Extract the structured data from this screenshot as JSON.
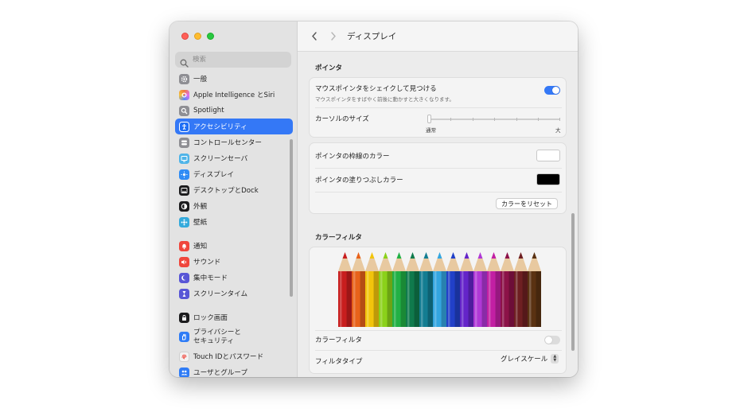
{
  "window": {
    "title": "ディスプレイ"
  },
  "search": {
    "placeholder": "検索"
  },
  "sidebar": {
    "items": [
      {
        "label": "一般",
        "icon": "gear-icon",
        "color": "#8e8e93"
      },
      {
        "label": "Apple Intelligence とSiri",
        "icon": "apple-intelligence-icon",
        "color": "#e26ef0"
      },
      {
        "label": "Spotlight",
        "icon": "spotlight-icon",
        "color": "#8e8e93"
      },
      {
        "label": "アクセシビリティ",
        "icon": "accessibility-icon",
        "color": "#1f6ef5",
        "active": true
      },
      {
        "label": "コントロールセンター",
        "icon": "control-center-icon",
        "color": "#8e8e93"
      },
      {
        "label": "スクリーンセーバ",
        "icon": "screen-saver-icon",
        "color": "#4fb4e8"
      },
      {
        "label": "ディスプレイ",
        "icon": "display-icon",
        "color": "#2f8cf5"
      },
      {
        "label": "デスクトップとDock",
        "icon": "dock-icon",
        "color": "#1c1c1e"
      },
      {
        "label": "外観",
        "icon": "appearance-icon",
        "color": "#1c1c1e"
      },
      {
        "label": "壁紙",
        "icon": "wallpaper-icon",
        "color": "#34aadc"
      },
      {
        "label": "通知",
        "icon": "notifications-icon",
        "color": "#f0463c"
      },
      {
        "label": "サウンド",
        "icon": "sound-icon",
        "color": "#f0463c"
      },
      {
        "label": "集中モード",
        "icon": "focus-icon",
        "color": "#5856d6"
      },
      {
        "label": "スクリーンタイム",
        "icon": "screen-time-icon",
        "color": "#5856d6"
      },
      {
        "label": "ロック画面",
        "icon": "lock-screen-icon",
        "color": "#1c1c1e"
      },
      {
        "label": "プライバシーと\nセキュリティ",
        "icon": "privacy-hand-icon",
        "color": "#2f7cf6"
      },
      {
        "label": "Touch IDとパスワード",
        "icon": "fingerprint-icon",
        "color": "#f2f2f2"
      },
      {
        "label": "ユーザとグループ",
        "icon": "users-icon",
        "color": "#2f7cf6"
      }
    ]
  },
  "pointer": {
    "section_title": "ポインタ",
    "shake_label": "マウスポインタをシェイクして見つける",
    "shake_sub": "マウスポインタをすばやく前後に動かすと大きくなります。",
    "shake_on": true,
    "cursor_size_label": "カーソルのサイズ",
    "cursor_size_min": "通常",
    "cursor_size_max": "大",
    "cursor_size_value": 0.0,
    "outline_label": "ポインタの枠線のカラー",
    "outline_color": "#ffffff",
    "fill_label": "ポインタの塗りつぶしカラー",
    "fill_color": "#000000",
    "reset_button": "カラーをリセット"
  },
  "color_filter": {
    "section_title": "カラーフィルタ",
    "pencil_colors": [
      "#c81e1e",
      "#e8621a",
      "#f2c40c",
      "#8bd11a",
      "#22b045",
      "#0f7a4c",
      "#137d92",
      "#34a6e0",
      "#2140c8",
      "#6424c9",
      "#b038d6",
      "#c21fa3",
      "#8c1248",
      "#6e1f22",
      "#5a3212"
    ],
    "filter_label": "カラーフィルタ",
    "filter_on": false,
    "type_label": "フィルタタイプ",
    "type_value": "グレイスケール"
  }
}
